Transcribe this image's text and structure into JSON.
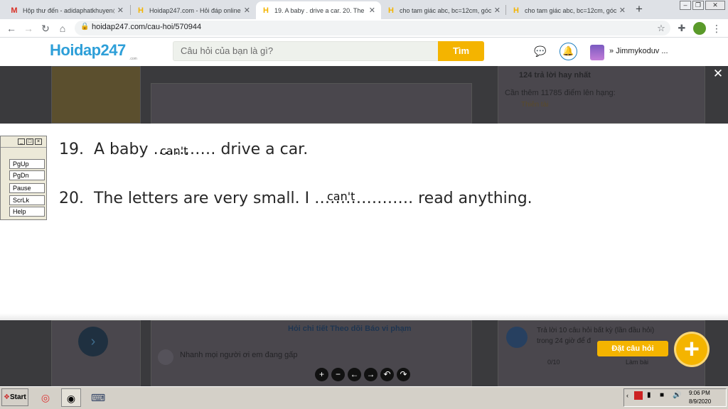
{
  "browser": {
    "tabs": [
      {
        "title": "Hộp thư đến - adidaphatkhuyen@g",
        "favicon": "gmail-icon",
        "active": false
      },
      {
        "title": "Hoidap247.com - Hỏi đáp online nh",
        "favicon": "hoidap-icon",
        "active": false
      },
      {
        "title": "19. A baby . drive a car. 20. The le",
        "favicon": "hoidap-icon",
        "active": true
      },
      {
        "title": "cho tam giác abc, bc=12cm, góc b",
        "favicon": "hoidap-icon",
        "active": false
      },
      {
        "title": "cho tam giác abc, bc=12cm, góc b",
        "favicon": "hoidap-icon",
        "active": false
      }
    ],
    "new_tab": "+",
    "url": "hoidap247.com/cau-hoi/570944"
  },
  "site": {
    "logo_main": "Hoidap247",
    "logo_sub": ".com",
    "search_placeholder": "Câu hỏi của bạn là gì?",
    "search_button": "Tìm",
    "username": "Jimmykoduv ..."
  },
  "background": {
    "best_answers": "124 trả lời hay nhất",
    "points_needed": "Cần thêm 11785 điểm lên hạng:",
    "rank": "Thiên tài",
    "detail_tabs": "Hỏi chi tiết    Theo dõi    Báo vi phạm",
    "reply_prompt": "Nhanh mọi người ơi em đang gấp",
    "promo_line1": "Trả lời 10 câu hỏi bất kỳ (lần đầu hỏi)",
    "promo_line2": "trong 24 giờ để đ",
    "progress": "0/10",
    "promo_action": "Làm bài"
  },
  "content": {
    "q19": {
      "number": "19.",
      "before": "A baby ",
      "dots": "…………",
      "after": " drive a car.",
      "answer": "can't"
    },
    "q20": {
      "number": "20.",
      "before": "The letters are very small. I ",
      "dots": "……………….",
      "after": " read anything.",
      "answer": "can't"
    }
  },
  "osk": {
    "keys": [
      "PgUp",
      "PgDn",
      "Pause",
      "ScrLk",
      "Help"
    ],
    "window_buttons": [
      "_",
      "□",
      "×"
    ]
  },
  "controls": [
    "+",
    "−",
    "←",
    "→",
    "↶",
    "↷"
  ],
  "ask": {
    "label": "Đặt câu hỏi",
    "plus": "+"
  },
  "taskbar": {
    "start": "Start",
    "time": "9:06 PM",
    "date": "8/9/2020"
  }
}
